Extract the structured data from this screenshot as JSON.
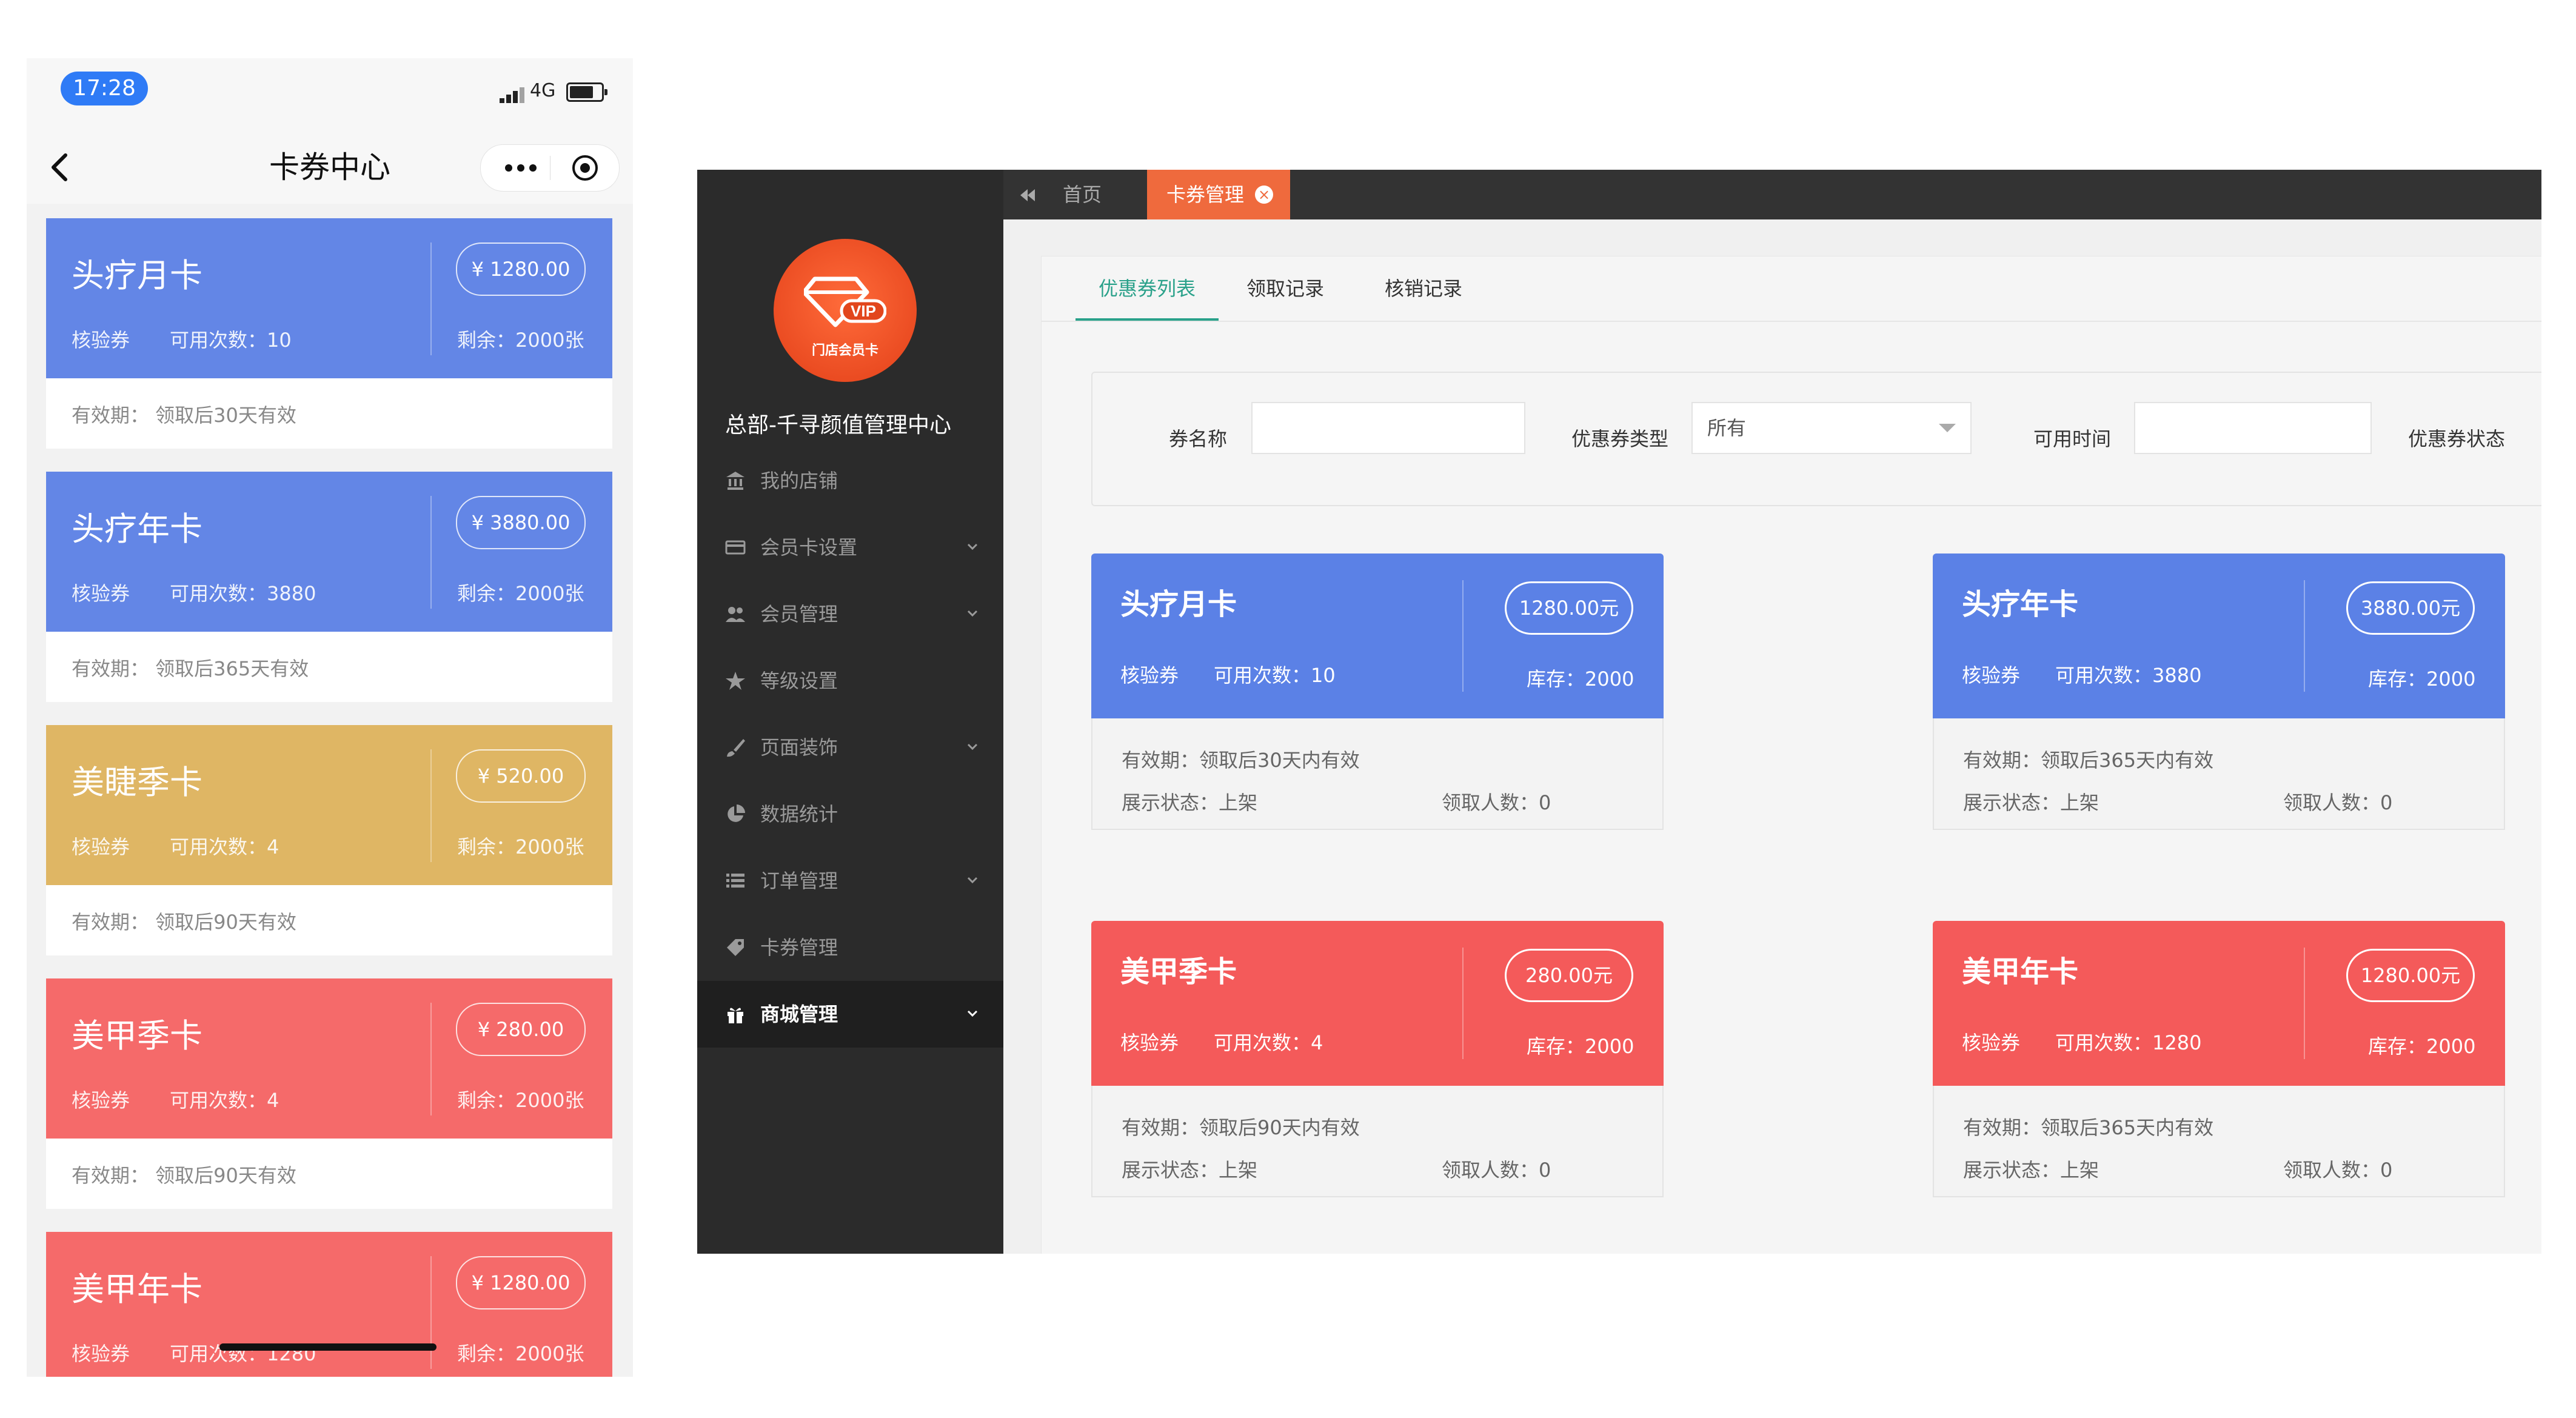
{
  "phone": {
    "time": "17:28",
    "network": "4G",
    "title": "卡券中心",
    "cards": [
      {
        "name": "头疗月卡",
        "price": "¥ 1280.00",
        "type": "核验券",
        "uses": "可用次数：10",
        "remaining": "剩余：2000张",
        "validity": "有效期：  领取后30天有效",
        "color": "#6386e6"
      },
      {
        "name": "头疗年卡",
        "price": "¥ 3880.00",
        "type": "核验券",
        "uses": "可用次数：3880",
        "remaining": "剩余：2000张",
        "validity": "有效期：  领取后365天有效",
        "color": "#6386e6"
      },
      {
        "name": "美睫季卡",
        "price": "¥ 520.00",
        "type": "核验券",
        "uses": "可用次数：4",
        "remaining": "剩余：2000张",
        "validity": "有效期：  领取后90天有效",
        "color": "#dfb664"
      },
      {
        "name": "美甲季卡",
        "price": "¥ 280.00",
        "type": "核验券",
        "uses": "可用次数：4",
        "remaining": "剩余：2000张",
        "validity": "有效期：  领取后90天有效",
        "color": "#f56a6a"
      },
      {
        "name": "美甲年卡",
        "price": "¥ 1280.00",
        "type": "核验券",
        "uses": "可用次数：1280",
        "remaining": "剩余：2000张",
        "validity": "",
        "color": "#f56a6a"
      }
    ]
  },
  "admin": {
    "tabs": {
      "home": "首页",
      "active": "卡券管理"
    },
    "org_name": "总部-千寻颜值管理中心",
    "logo": {
      "badge": "VIP",
      "caption": "门店会员卡"
    },
    "menu": [
      {
        "label": "我的店铺",
        "icon": "bank-icon",
        "arrow": false
      },
      {
        "label": "会员卡设置",
        "icon": "card-icon",
        "arrow": true
      },
      {
        "label": "会员管理",
        "icon": "users-icon",
        "arrow": true
      },
      {
        "label": "等级设置",
        "icon": "star-icon",
        "arrow": false
      },
      {
        "label": "页面装饰",
        "icon": "brush-icon",
        "arrow": true
      },
      {
        "label": "数据统计",
        "icon": "pie-chart-icon",
        "arrow": false
      },
      {
        "label": "订单管理",
        "icon": "list-icon",
        "arrow": true
      },
      {
        "label": "卡券管理",
        "icon": "tag-icon",
        "arrow": false
      },
      {
        "label": "商城管理",
        "icon": "gift-icon",
        "arrow": true
      }
    ],
    "subtabs": [
      "优惠券列表",
      "领取记录",
      "核销记录"
    ],
    "filter": {
      "name_label": "券名称",
      "type_label": "优惠券类型",
      "type_value": "所有",
      "time_label": "可用时间",
      "status_label": "优惠券状态"
    },
    "cards": [
      {
        "name": "头疗月卡",
        "price": "1280.00元",
        "type": "核验券",
        "uses": "可用次数：10",
        "stock": "库存：2000",
        "validity": "有效期：领取后30天内有效",
        "display": "展示状态：上架",
        "receivers": "领取人数：0",
        "color": "#5b81e6"
      },
      {
        "name": "头疗年卡",
        "price": "3880.00元",
        "type": "核验券",
        "uses": "可用次数：3880",
        "stock": "库存：2000",
        "validity": "有效期：领取后365天内有效",
        "display": "展示状态：上架",
        "receivers": "领取人数：0",
        "color": "#5b81e6"
      },
      {
        "name": "美甲季卡",
        "price": "280.00元",
        "type": "核验券",
        "uses": "可用次数：4",
        "stock": "库存：2000",
        "validity": "有效期：领取后90天内有效",
        "display": "展示状态：上架",
        "receivers": "领取人数：0",
        "color": "#f45a5a"
      },
      {
        "name": "美甲年卡",
        "price": "1280.00元",
        "type": "核验券",
        "uses": "可用次数：1280",
        "stock": "库存：2000",
        "validity": "有效期：领取后365天内有效",
        "display": "展示状态：上架",
        "receivers": "领取人数：0",
        "color": "#f45a5a"
      }
    ]
  }
}
